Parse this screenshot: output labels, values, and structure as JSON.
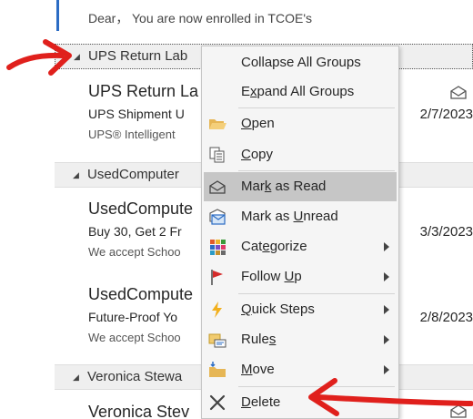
{
  "mail_list": {
    "top_snippet": "Dear， You are now enrolled in TCOE's",
    "groups": [
      {
        "name": "UPS Return Lab",
        "email": {
          "sender": "UPS Return La",
          "subject": "UPS Shipment U",
          "preview": "UPS® Intelligent",
          "date": "2/7/2023",
          "icon": "envelope-open-icon"
        }
      },
      {
        "name": "UsedComputer",
        "emails": [
          {
            "sender": "UsedCompute",
            "subject": "Buy 30, Get 2 Fr",
            "preview": "We accept Schoo",
            "date": "3/3/2023"
          },
          {
            "sender": "UsedCompute",
            "subject": "Future-Proof Yo",
            "preview": "We accept Schoo",
            "date": "2/8/2023"
          }
        ]
      },
      {
        "name": "Veronica Stewa",
        "email": {
          "sender": "Veronica Stev",
          "icon": "envelope-open-icon"
        }
      }
    ]
  },
  "context_menu": {
    "items": [
      {
        "label_pre": "Collapse All Groups",
        "mnemonic": "",
        "label_post": "",
        "icon": "",
        "submenu": false
      },
      {
        "label_pre": "E",
        "mnemonic": "x",
        "label_post": "pand All Groups",
        "icon": "",
        "submenu": false
      },
      {
        "label_pre": "",
        "mnemonic": "O",
        "label_post": "pen",
        "icon": "folder-open-icon",
        "submenu": false
      },
      {
        "label_pre": "",
        "mnemonic": "C",
        "label_post": "opy",
        "icon": "copy-icon",
        "submenu": false
      },
      {
        "label_pre": "Mar",
        "mnemonic": "k",
        "label_post": " as Read",
        "icon": "envelope-open-icon",
        "submenu": false,
        "highlighted": true
      },
      {
        "label_pre": "Mark as ",
        "mnemonic": "U",
        "label_post": "nread",
        "icon": "envelope-unread-icon",
        "submenu": false
      },
      {
        "label_pre": "Cat",
        "mnemonic": "e",
        "label_post": "gorize",
        "icon": "categorize-icon",
        "submenu": true
      },
      {
        "label_pre": "Follow ",
        "mnemonic": "U",
        "label_post": "p",
        "icon": "flag-icon",
        "submenu": true
      },
      {
        "label_pre": "",
        "mnemonic": "Q",
        "label_post": "uick Steps",
        "icon": "lightning-icon",
        "submenu": true
      },
      {
        "label_pre": "Rule",
        "mnemonic": "s",
        "label_post": "",
        "icon": "rules-icon",
        "submenu": true
      },
      {
        "label_pre": "",
        "mnemonic": "M",
        "label_post": "ove",
        "icon": "move-folder-icon",
        "submenu": true
      },
      {
        "label_pre": "",
        "mnemonic": "D",
        "label_post": "elete",
        "icon": "delete-x-icon",
        "submenu": false
      }
    ]
  },
  "colors": {
    "annotation_red": "#e0201c",
    "selection_blue": "#2b6cc4",
    "menu_highlight": "#c6c6c6"
  }
}
